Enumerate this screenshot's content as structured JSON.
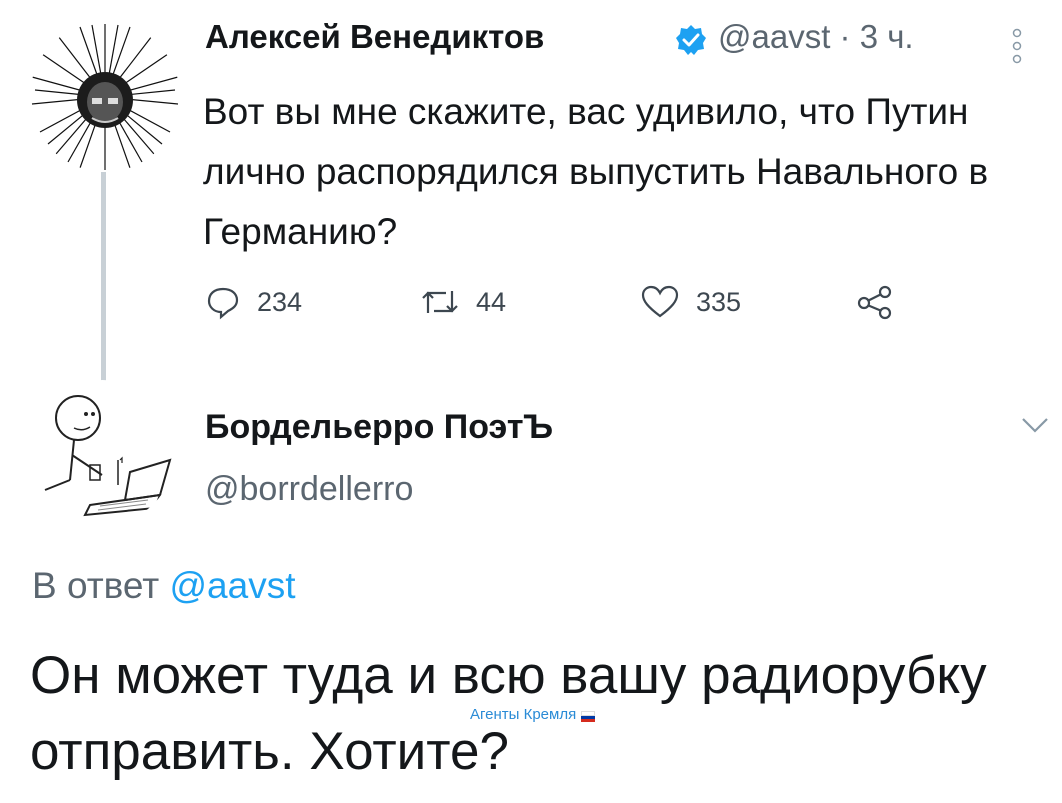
{
  "original_tweet": {
    "author_name": "Алексей Венедиктов",
    "handle_time": "@aavst · 3 ч.",
    "text": "Вот вы мне скажите, вас удивило, что Путин лично распорядился выпустить Навального в Германию?",
    "verified_icon": "verified-badge-icon",
    "actions": {
      "reply_count": "234",
      "retweet_count": "44",
      "like_count": "335"
    }
  },
  "reply_tweet": {
    "author_name": "Бордельерро ПоэтЪ",
    "handle": "@borrdellerro",
    "reply_prefix": "В ответ ",
    "reply_mention": "@aavst",
    "text": "Он может туда и всю вашу радиорубку отправить. Хотите?"
  },
  "watermark": {
    "text": "Агенты Кремля",
    "icon": "russian-flag-icon"
  },
  "colors": {
    "link": "#1da1f2",
    "verified": "#1da1f2",
    "secondary_text": "#5b6670",
    "thread_line": "#c8d0d6"
  }
}
